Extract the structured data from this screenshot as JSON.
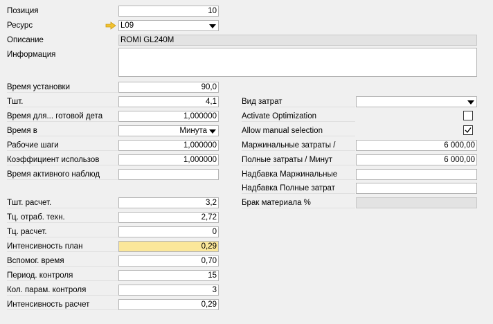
{
  "fields": {
    "position": {
      "label": "Позиция",
      "value": "10"
    },
    "resource": {
      "label": "Ресурс",
      "value": "L09"
    },
    "description": {
      "label": "Описание",
      "value": "ROMI GL240M"
    },
    "information": {
      "label": "Информация",
      "value": ""
    },
    "setup_time": {
      "label": "Время установки",
      "value": "90,0"
    },
    "pieces": {
      "label": "Тшт.",
      "value": "4,1"
    },
    "time_finished": {
      "label": "Время для... готовой дета",
      "value": "1,000000"
    },
    "time_in": {
      "label": "Время в",
      "value": "Минута"
    },
    "work_steps": {
      "label": "Рабочие шаги",
      "value": "1,000000"
    },
    "usage_coef": {
      "label": "Коэффициент использов",
      "value": "1,000000"
    },
    "active_obs_time": {
      "label": "Время активного наблюд",
      "value": ""
    },
    "pieces_calc": {
      "label": "Тшт. расчет.",
      "value": "3,2"
    },
    "tc_tech": {
      "label": "Тц. отраб. техн.",
      "value": "2,72"
    },
    "tc_calc": {
      "label": "Тц. расчет.",
      "value": "0"
    },
    "intensity_plan": {
      "label": "Интенсивность план",
      "value": "0,29"
    },
    "aux_time": {
      "label": "Вспомог. время",
      "value": "0,70"
    },
    "control_period": {
      "label": "Период. контроля",
      "value": "15"
    },
    "control_params": {
      "label": "Кол. парам. контроля",
      "value": "3"
    },
    "intensity_calc": {
      "label": "Интенсивность расчет",
      "value": "0,29"
    },
    "cost_type": {
      "label": "Вид затрат",
      "value": ""
    },
    "activate_optimization": {
      "label": "Activate Optimization",
      "checked": false
    },
    "allow_manual_selection": {
      "label": "Allow manual selection",
      "checked": true
    },
    "marginal_costs": {
      "label": "Маржинальные затраты /",
      "value": "6 000,00"
    },
    "full_costs": {
      "label": "Полные затраты / Минут",
      "value": "6 000,00"
    },
    "marginal_markup": {
      "label": "Надбавка Маржинальные",
      "value": ""
    },
    "full_markup": {
      "label": "Надбавка Полные затрат",
      "value": ""
    },
    "material_scrap": {
      "label": "Брак материала %",
      "value": ""
    }
  },
  "colors": {
    "highlight": "#fbe79a",
    "arrow": "#f2c230"
  }
}
